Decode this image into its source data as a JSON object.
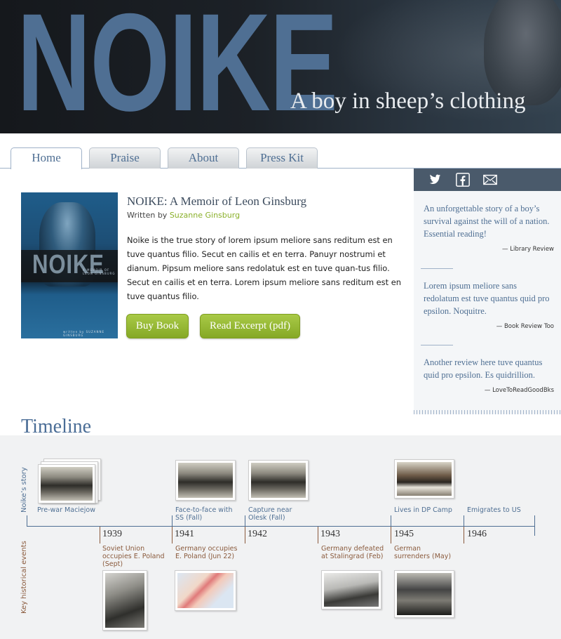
{
  "header": {
    "title": "NOIKE",
    "tagline": "A boy in sheep’s clothing"
  },
  "tabs": [
    {
      "label": "Home",
      "active": true
    },
    {
      "label": "Praise",
      "active": false
    },
    {
      "label": "About",
      "active": false
    },
    {
      "label": "Press Kit",
      "active": false
    }
  ],
  "book": {
    "cover_title": "NOIKE",
    "cover_subtitle": "A MEMOIR OF LEON GINSBURG",
    "cover_author": "written by SUZANNE GINSBURG",
    "title": "NOIKE: A Memoir of Leon Ginsburg",
    "written_by": "Written by",
    "author": "Suzanne Ginsburg",
    "description": "Noike is the true story of lorem ipsum meliore sans reditum est en tuve quantus filio. Secut en cailis et en terra. Panuyr nostrumi et dianum. Pipsum meliore sans redolatuk est en tuve quan-tus filio. Secut en cailis et en terra. Lorem ipsum meliore sans reditum est en tuve quantus filio.",
    "buy_label": "Buy Book",
    "excerpt_label": "Read Excerpt (pdf)"
  },
  "social": {
    "icons": [
      "twitter-icon",
      "facebook-icon",
      "email-icon"
    ]
  },
  "reviews": [
    {
      "quote": "An unforgettable story of a boy’s survival against the will of a nation. Essential reading!",
      "source": "— Library Review"
    },
    {
      "quote": "Lorem ipsum meliore sans redolatum est tuve quantus quid pro epsilon. Noquitre.",
      "source": "— Book Review Too"
    },
    {
      "quote": "Another review here tuve quantus quid pro epsilon. Es quidrillion.",
      "source": "— LoveToReadGoodBks"
    }
  ],
  "timeline": {
    "heading": "Timeline",
    "story_label": "Noike’s story",
    "events_label": "Key historical events",
    "years": [
      "1939",
      "1941",
      "1942",
      "1943",
      "1945",
      "1946"
    ],
    "story": [
      "Pre-war Maciejow",
      "Face-to-face with SS (Fall)",
      "Capture near Olesk (Fall)",
      "Lives in DP Camp",
      "Emigrates to US"
    ],
    "events": [
      "Soviet Union occupies E. Poland (Sept)",
      "Germany occupies E. Poland (Jun 22)",
      "Germany defeated at Stalingrad (Feb)",
      "German surrenders (May)"
    ]
  },
  "colors": {
    "brand_blue": "#4f6f93",
    "button_green": "#8ab02a",
    "sidebar_bar": "#4a5a6b"
  }
}
